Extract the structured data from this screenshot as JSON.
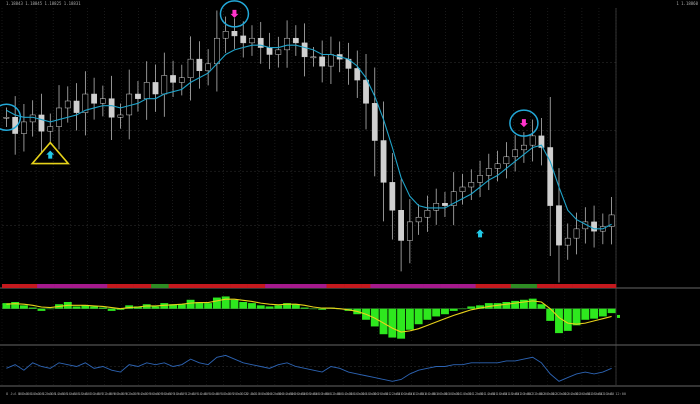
{
  "window": {
    "symbol_info": "1.18843  1.18845  1.18825  1.18831",
    "corner_label": "1 1.18860"
  },
  "colors": {
    "background": "#000000",
    "candle": "#d0d0d0",
    "ma_line": "#1fa3c9",
    "marker_circle": "#22a8d8",
    "marker_triangle": "#e6d21a",
    "arrow_down": "#ff33cc",
    "arrow_up": "#22c8e6",
    "hist_green": "#2ee81e",
    "signal_yellow": "#e8d21a",
    "osc_blue": "#2d64b4",
    "session_red": "#c4191e",
    "session_magenta": "#a51a8c",
    "session_green": "#2e8c23"
  },
  "chart_data": [
    {
      "type": "line",
      "name": "price",
      "series": [
        {
          "role": "close",
          "values": [
            1.1878,
            1.1871,
            1.1876,
            1.1879,
            1.1872,
            1.1874,
            1.1882,
            1.1885,
            1.188,
            1.1888,
            1.1884,
            1.1886,
            1.1878,
            1.1879,
            1.1888,
            1.1886,
            1.1893,
            1.1888,
            1.1896,
            1.1893,
            1.1895,
            1.1903,
            1.1898,
            1.1901,
            1.1912,
            1.1915,
            1.1913,
            1.191,
            1.1912,
            1.1908,
            1.1905,
            1.1907,
            1.1912,
            1.191,
            1.1904,
            1.1904,
            1.19,
            1.1905,
            1.1903,
            1.1899,
            1.1894,
            1.1884,
            1.1868,
            1.185,
            1.1838,
            1.1825,
            1.1833,
            1.1835,
            1.1838,
            1.1841,
            1.184,
            1.1846,
            1.1848,
            1.185,
            1.1853,
            1.1856,
            1.1858,
            1.1861,
            1.1864,
            1.1866,
            1.187,
            1.1865,
            1.184,
            1.1823,
            1.1826,
            1.183,
            1.1833,
            1.1829,
            1.1831,
            1.1836
          ]
        },
        {
          "role": "moving-average",
          "values": [
            1.1881,
            1.1879,
            1.1878,
            1.1878,
            1.1877,
            1.1876,
            1.1877,
            1.1878,
            1.1879,
            1.1881,
            1.1882,
            1.1883,
            1.1883,
            1.1882,
            1.1883,
            1.1884,
            1.1886,
            1.1886,
            1.1888,
            1.1889,
            1.189,
            1.1893,
            1.1895,
            1.1897,
            1.1901,
            1.1905,
            1.1907,
            1.1908,
            1.1909,
            1.1909,
            1.1908,
            1.1908,
            1.1909,
            1.1909,
            1.1908,
            1.1907,
            1.1905,
            1.1905,
            1.1904,
            1.1903,
            1.19,
            1.1895,
            1.1887,
            1.1877,
            1.1865,
            1.1852,
            1.1844,
            1.184,
            1.1839,
            1.1839,
            1.1839,
            1.1841,
            1.1843,
            1.1845,
            1.1848,
            1.1851,
            1.1853,
            1.1856,
            1.1859,
            1.1862,
            1.1865,
            1.1866,
            1.1859,
            1.1848,
            1.1838,
            1.1834,
            1.1832,
            1.183,
            1.183,
            1.1832
          ]
        }
      ],
      "ylim": [
        1.1808,
        1.1925
      ],
      "markers": [
        {
          "kind": "circle",
          "bar": 0
        },
        {
          "kind": "circle",
          "bar": 26,
          "arrow": "down"
        },
        {
          "kind": "triangle",
          "bar": 5,
          "arrow": "up"
        },
        {
          "kind": "circle",
          "bar": 59,
          "arrow": "down"
        },
        {
          "kind": "arrow",
          "bar": 54,
          "arrow": "up"
        }
      ]
    },
    {
      "type": "bar",
      "name": "histogram",
      "values": [
        0.5,
        0.6,
        0.3,
        0.1,
        -0.2,
        0.0,
        0.4,
        0.6,
        0.2,
        0.3,
        0.2,
        0.1,
        -0.2,
        -0.1,
        0.3,
        0.2,
        0.4,
        0.2,
        0.5,
        0.4,
        0.4,
        0.8,
        0.6,
        0.5,
        1.0,
        1.1,
        0.8,
        0.6,
        0.5,
        0.3,
        0.2,
        0.3,
        0.5,
        0.4,
        0.1,
        0.0,
        -0.1,
        0.1,
        0.0,
        -0.2,
        -0.5,
        -1.0,
        -1.6,
        -2.3,
        -2.6,
        -2.7,
        -1.9,
        -1.4,
        -1.0,
        -0.7,
        -0.5,
        -0.2,
        0.0,
        0.2,
        0.3,
        0.5,
        0.5,
        0.6,
        0.7,
        0.8,
        0.9,
        0.4,
        -1.1,
        -2.2,
        -2.0,
        -1.5,
        -1.0,
        -0.9,
        -0.7,
        -0.4
      ],
      "signal": [
        0.4,
        0.45,
        0.4,
        0.3,
        0.15,
        0.1,
        0.2,
        0.3,
        0.3,
        0.3,
        0.25,
        0.2,
        0.1,
        0.0,
        0.1,
        0.15,
        0.25,
        0.25,
        0.3,
        0.35,
        0.4,
        0.5,
        0.55,
        0.55,
        0.7,
        0.85,
        0.85,
        0.75,
        0.65,
        0.5,
        0.4,
        0.35,
        0.4,
        0.4,
        0.3,
        0.15,
        0.05,
        0.05,
        0.0,
        -0.1,
        -0.25,
        -0.5,
        -0.85,
        -1.3,
        -1.75,
        -2.1,
        -2.0,
        -1.8,
        -1.5,
        -1.2,
        -0.9,
        -0.6,
        -0.35,
        -0.1,
        0.05,
        0.2,
        0.3,
        0.4,
        0.5,
        0.6,
        0.7,
        0.6,
        0.0,
        -0.8,
        -1.3,
        -1.4,
        -1.3,
        -1.1,
        -0.9,
        -0.7
      ],
      "ylim": [
        -3,
        1.5
      ]
    },
    {
      "type": "line",
      "name": "oscillator",
      "values": [
        0.45,
        0.55,
        0.4,
        0.6,
        0.5,
        0.45,
        0.6,
        0.55,
        0.5,
        0.6,
        0.45,
        0.5,
        0.4,
        0.35,
        0.55,
        0.5,
        0.6,
        0.55,
        0.6,
        0.5,
        0.55,
        0.7,
        0.6,
        0.55,
        0.75,
        0.8,
        0.7,
        0.6,
        0.55,
        0.5,
        0.45,
        0.55,
        0.6,
        0.5,
        0.45,
        0.4,
        0.35,
        0.5,
        0.45,
        0.35,
        0.3,
        0.25,
        0.2,
        0.15,
        0.1,
        0.15,
        0.3,
        0.4,
        0.45,
        0.5,
        0.5,
        0.55,
        0.55,
        0.6,
        0.6,
        0.6,
        0.6,
        0.65,
        0.65,
        0.7,
        0.75,
        0.6,
        0.3,
        0.1,
        0.2,
        0.3,
        0.35,
        0.3,
        0.35,
        0.45
      ],
      "ylim": [
        0,
        1
      ]
    }
  ],
  "session_bar": [
    "red",
    "red",
    "red",
    "red",
    "magenta",
    "magenta",
    "magenta",
    "magenta",
    "magenta",
    "magenta",
    "magenta",
    "magenta",
    "red",
    "red",
    "red",
    "red",
    "red",
    "green",
    "green",
    "red",
    "red",
    "red",
    "red",
    "red",
    "red",
    "red",
    "red",
    "red",
    "red",
    "red",
    "magenta",
    "magenta",
    "magenta",
    "magenta",
    "magenta",
    "magenta",
    "magenta",
    "red",
    "red",
    "red",
    "red",
    "red",
    "magenta",
    "magenta",
    "magenta",
    "magenta",
    "magenta",
    "magenta",
    "magenta",
    "magenta",
    "magenta",
    "magenta",
    "magenta",
    "magenta",
    "red",
    "red",
    "red",
    "red",
    "green",
    "green",
    "green",
    "red",
    "red",
    "red",
    "red",
    "red",
    "red",
    "red",
    "red",
    "red"
  ],
  "time_axis": [
    "8 Jul 08:00",
    "8 Jul 10:00",
    "8 Jul 12:00",
    "8 Jul 14:00",
    "8 Jul 16:00",
    "8 Jul 18:00",
    "8 Jul 20:00",
    "8 Jul 22:00",
    "9 Jul 00:00",
    "9 Jul 02:00",
    "9 Jul 04:00",
    "9 Jul 06:00",
    "9 Jul 08:00",
    "9 Jul 10:00",
    "9 Jul 12:00",
    "9 Jul 14:00",
    "9 Jul 16:00",
    "9 Jul 18:00",
    "9 Jul 20:00",
    "9 Jul 22:00",
    "10 Jul 00:00",
    "10 Jul 02:00",
    "10 Jul 04:00",
    "10 Jul 06:00",
    "10 Jul 08:00",
    "10 Jul 10:00",
    "10 Jul 12:00",
    "10 Jul 14:00",
    "10 Jul 16:00",
    "10 Jul 18:00",
    "10 Jul 20:00",
    "10 Jul 22:00",
    "11 Jul 00:00",
    "11 Jul 02:00",
    "11 Jul 04:00",
    "11 Jul 06:00",
    "11 Jul 08:00",
    "11 Jul 10:00",
    "11 Jul 12:00",
    "11 Jul 14:00",
    "11 Jul 16:00",
    "11 Jul 18:00",
    "11 Jul 20:00",
    "11 Jul 22:00",
    "12 Jul 00:00",
    "12 Jul 02:00",
    "12 Jul 04:00",
    "12 Jul 06:00",
    "12 Jul 08:00",
    "12 Jul 10:00",
    "12 Jul 12:00"
  ]
}
